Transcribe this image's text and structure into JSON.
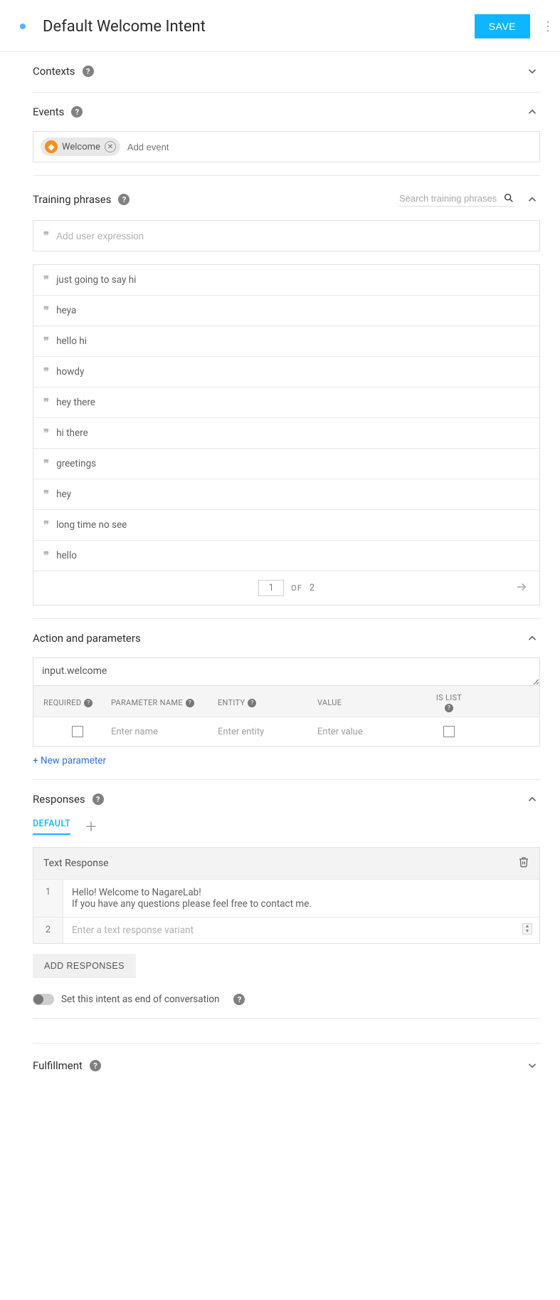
{
  "header": {
    "title": "Default Welcome Intent",
    "save_label": "SAVE"
  },
  "contexts": {
    "title": "Contexts"
  },
  "events": {
    "title": "Events",
    "chip_label": "Welcome",
    "add_placeholder": "Add event"
  },
  "training": {
    "title": "Training phrases",
    "search_placeholder": "Search training phrases",
    "add_placeholder": "Add user expression",
    "phrases": [
      "just going to say hi",
      "heya",
      "hello hi",
      "howdy",
      "hey there",
      "hi there",
      "greetings",
      "hey",
      "long time no see",
      "hello"
    ],
    "pager": {
      "current": "1",
      "of_label": "OF",
      "total": "2"
    }
  },
  "action": {
    "title": "Action and parameters",
    "value": "input.welcome",
    "cols": {
      "required": "REQUIRED",
      "name": "PARAMETER NAME",
      "entity": "ENTITY",
      "value": "VALUE",
      "islist": "IS LIST"
    },
    "row_placeholders": {
      "name": "Enter name",
      "entity": "Enter entity",
      "value": "Enter value"
    },
    "new_param": "+ New parameter"
  },
  "responses": {
    "title": "Responses",
    "tab_default": "DEFAULT",
    "box_title": "Text Response",
    "rows": {
      "r1_num": "1",
      "r1_text": "Hello! Welcome to NagareLab!\nIf you have any questions please feel free to contact me.",
      "r2_num": "2",
      "r2_placeholder": "Enter a text response variant"
    },
    "add_btn": "ADD RESPONSES",
    "eoc_label": "Set this intent as end of conversation"
  },
  "fulfillment": {
    "title": "Fulfillment"
  }
}
